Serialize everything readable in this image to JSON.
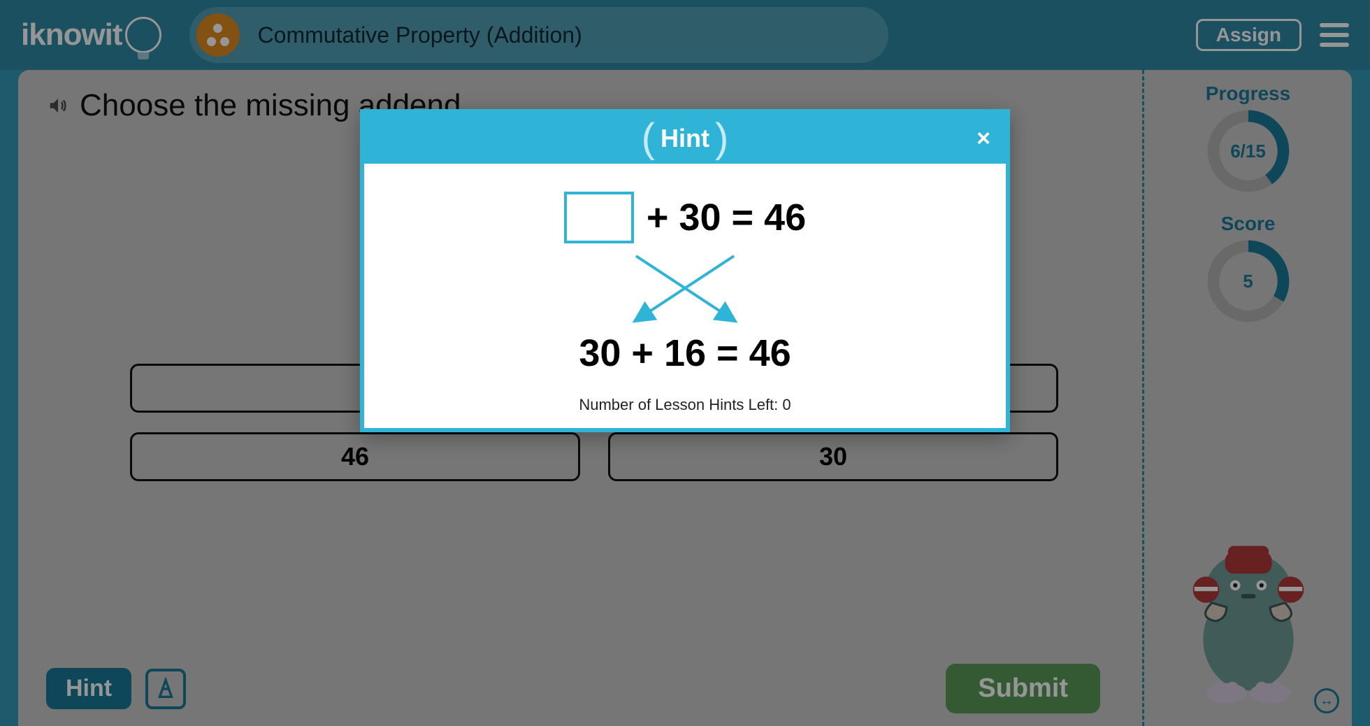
{
  "header": {
    "logo_text": "iknowit",
    "topic_title": "Commutative Property (Addition)",
    "assign_label": "Assign"
  },
  "question": {
    "prompt": "Choose the missing addend.",
    "answers": [
      "",
      "",
      "46",
      "30"
    ]
  },
  "buttons": {
    "hint": "Hint",
    "submit": "Submit"
  },
  "sidebar": {
    "progress_label": "Progress",
    "progress_text": "6/15",
    "progress_done": 6,
    "progress_total": 15,
    "score_label": "Score",
    "score_text": "5",
    "score_done": 5,
    "score_total": 15
  },
  "modal": {
    "title": "Hint",
    "eq1_box": "",
    "eq1_rest": "+ 30 =  46",
    "eq2": "30 + 16 =  46",
    "hints_left_label": "Number of Lesson Hints Left: ",
    "hints_left_value": "0"
  },
  "colors": {
    "brand": "#2d8aa5",
    "accent": "#2fb4d8",
    "submit": "#5a9a5a",
    "badge": "#e08b1f"
  }
}
